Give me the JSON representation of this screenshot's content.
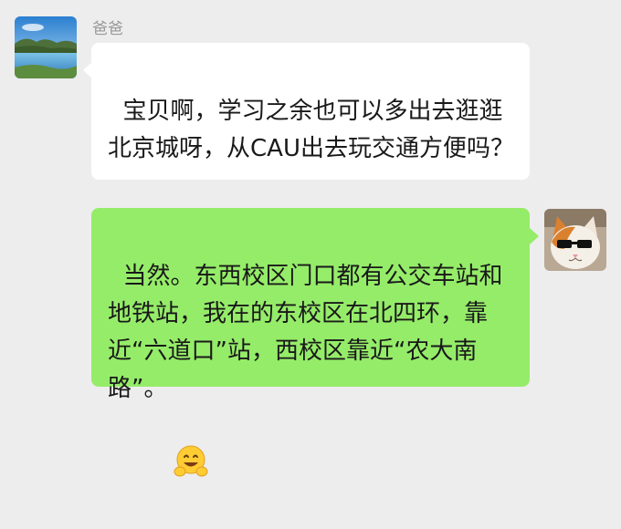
{
  "chat": {
    "incoming": {
      "sender_name": "爸爸",
      "text": "宝贝啊，学习之余也可以多出去逛逛北京城呀，从CAU出去玩交通方便吗？",
      "avatar_icon": "landscape-avatar"
    },
    "outgoing": {
      "text": "当然。东西校区门口都有公交车站和地铁站，我在的东校区在北四环，靠近“六道口”站，西校区靠近“农大南路”。",
      "emoji_icon": "hugging-face-emoji",
      "avatar_icon": "cat-with-sunglasses-avatar"
    }
  },
  "colors": {
    "background": "#ededed",
    "incoming_bubble": "#ffffff",
    "outgoing_bubble": "#95ec69"
  }
}
